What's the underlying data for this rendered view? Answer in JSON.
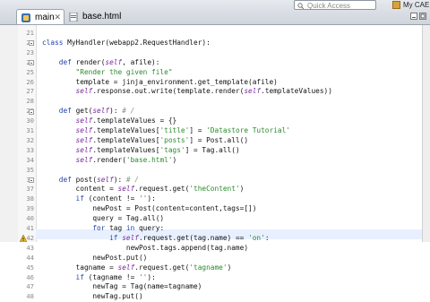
{
  "tabs": [
    {
      "label": "main",
      "active": true
    },
    {
      "label": "base.html",
      "active": false
    }
  ],
  "quick_access": {
    "placeholder": "Quick Access"
  },
  "perspective": {
    "label": "My CAE"
  },
  "lines": [
    {
      "n": "21",
      "tokens": []
    },
    {
      "n": "22",
      "tokens": [
        [
          "kw",
          "class "
        ],
        [
          "cls",
          "MyHandler"
        ],
        [
          "fn",
          "(webapp2.RequestHandler):"
        ]
      ]
    },
    {
      "n": "23",
      "tokens": []
    },
    {
      "n": "24",
      "tokens": [
        [
          "kw",
          "    def "
        ],
        [
          "fn",
          "render("
        ],
        [
          "self",
          "self"
        ],
        [
          "fn",
          ", afile):"
        ]
      ]
    },
    {
      "n": "25",
      "tokens": [
        [
          "str",
          "        \"Render the given file\""
        ]
      ]
    },
    {
      "n": "26",
      "tokens": [
        [
          "fn",
          "        template = jinja_environment.get_template(afile)"
        ]
      ]
    },
    {
      "n": "27",
      "tokens": [
        [
          "self",
          "        self"
        ],
        [
          "fn",
          ".response.out.write(template.render("
        ],
        [
          "self",
          "self"
        ],
        [
          "fn",
          ".templateValues))"
        ]
      ]
    },
    {
      "n": "28",
      "tokens": []
    },
    {
      "n": "29",
      "tokens": [
        [
          "kw",
          "    def "
        ],
        [
          "fn",
          "get("
        ],
        [
          "self",
          "self"
        ],
        [
          "fn",
          "):"
        ],
        [
          "cm",
          " # /"
        ]
      ]
    },
    {
      "n": "30",
      "tokens": [
        [
          "self",
          "        self"
        ],
        [
          "fn",
          ".templateValues = {}"
        ]
      ]
    },
    {
      "n": "31",
      "tokens": [
        [
          "self",
          "        self"
        ],
        [
          "fn",
          ".templateValues["
        ],
        [
          "str",
          "'title'"
        ],
        [
          "fn",
          "] = "
        ],
        [
          "str",
          "'Datastore Tutorial'"
        ]
      ]
    },
    {
      "n": "32",
      "tokens": [
        [
          "self",
          "        self"
        ],
        [
          "fn",
          ".templateValues["
        ],
        [
          "str",
          "'posts'"
        ],
        [
          "fn",
          "] = Post.all()"
        ]
      ]
    },
    {
      "n": "33",
      "tokens": [
        [
          "self",
          "        self"
        ],
        [
          "fn",
          ".templateValues["
        ],
        [
          "str",
          "'tags'"
        ],
        [
          "fn",
          "] = Tag.all()"
        ]
      ]
    },
    {
      "n": "34",
      "tokens": [
        [
          "self",
          "        self"
        ],
        [
          "fn",
          ".render("
        ],
        [
          "str",
          "'base.html'"
        ],
        [
          "fn",
          ")"
        ]
      ]
    },
    {
      "n": "35",
      "tokens": []
    },
    {
      "n": "36",
      "tokens": [
        [
          "kw",
          "    def "
        ],
        [
          "fn",
          "post("
        ],
        [
          "self",
          "self"
        ],
        [
          "fn",
          "):"
        ],
        [
          "cm",
          " # /"
        ]
      ]
    },
    {
      "n": "37",
      "tokens": [
        [
          "fn",
          "        content = "
        ],
        [
          "self",
          "self"
        ],
        [
          "fn",
          ".request.get("
        ],
        [
          "str",
          "'theContent'"
        ],
        [
          "fn",
          ")"
        ]
      ]
    },
    {
      "n": "38",
      "tokens": [
        [
          "kw",
          "        if "
        ],
        [
          "fn",
          "(content != "
        ],
        [
          "str",
          "''"
        ],
        [
          "fn",
          "):"
        ]
      ]
    },
    {
      "n": "39",
      "tokens": [
        [
          "fn",
          "            newPost = Post(content=content,tags=[])"
        ]
      ]
    },
    {
      "n": "40",
      "tokens": [
        [
          "fn",
          "            query = Tag.all()"
        ]
      ]
    },
    {
      "n": "41",
      "tokens": [
        [
          "kw",
          "            for "
        ],
        [
          "fn",
          "tag "
        ],
        [
          "kw",
          "in "
        ],
        [
          "fn",
          "query:"
        ]
      ]
    },
    {
      "n": "42",
      "tokens": [
        [
          "kw",
          "                if "
        ],
        [
          "self",
          "self"
        ],
        [
          "fn",
          ".request.get(tag.name) == "
        ],
        [
          "str",
          "'on'"
        ],
        [
          "fn",
          ":"
        ]
      ]
    },
    {
      "n": "43",
      "tokens": [
        [
          "fn",
          "                    newPost.tags.append(tag.name)"
        ]
      ]
    },
    {
      "n": "44",
      "tokens": [
        [
          "fn",
          "            newPost.put()"
        ]
      ]
    },
    {
      "n": "45",
      "tokens": [
        [
          "fn",
          "        tagname = "
        ],
        [
          "self",
          "self"
        ],
        [
          "fn",
          ".request.get("
        ],
        [
          "str",
          "'tagname'"
        ],
        [
          "fn",
          ")"
        ]
      ]
    },
    {
      "n": "46",
      "tokens": [
        [
          "kw",
          "        if "
        ],
        [
          "fn",
          "(tagname != "
        ],
        [
          "str",
          "''"
        ],
        [
          "fn",
          "):"
        ]
      ]
    },
    {
      "n": "47",
      "tokens": [
        [
          "fn",
          "            newTag = Tag(name=tagname)"
        ]
      ]
    },
    {
      "n": "48",
      "tokens": [
        [
          "fn",
          "            newTag.put()"
        ]
      ]
    }
  ]
}
